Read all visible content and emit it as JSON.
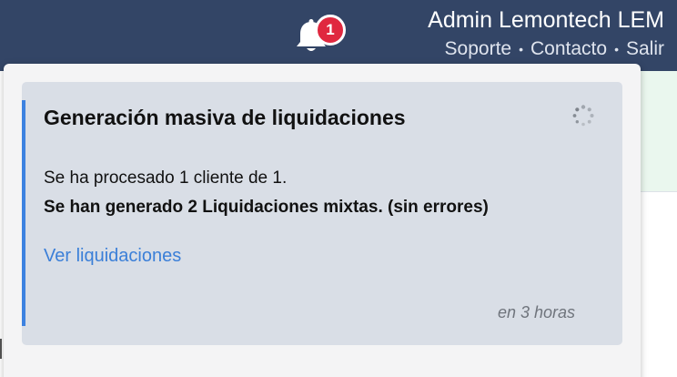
{
  "header": {
    "notification_count": "1",
    "user_name": "Admin Lemontech LEM",
    "links": {
      "support": "Soporte",
      "contact": "Contacto",
      "logout": "Salir"
    },
    "separator": "•"
  },
  "notification": {
    "title": "Generación masiva de liquidaciones",
    "message": "Se ha procesado 1 cliente de 1.",
    "result": "Se han generado 2 Liquidaciones mixtas. (sin errores)",
    "action_link": "Ver liquidaciones",
    "timestamp": "en 3 horas",
    "status_icon": "loading-spinner-icon"
  },
  "colors": {
    "header_bg": "#334566",
    "badge": "#e0283f",
    "accent": "#3d82e0",
    "link": "#3b7fd8",
    "card_bg": "#d9dee6"
  }
}
